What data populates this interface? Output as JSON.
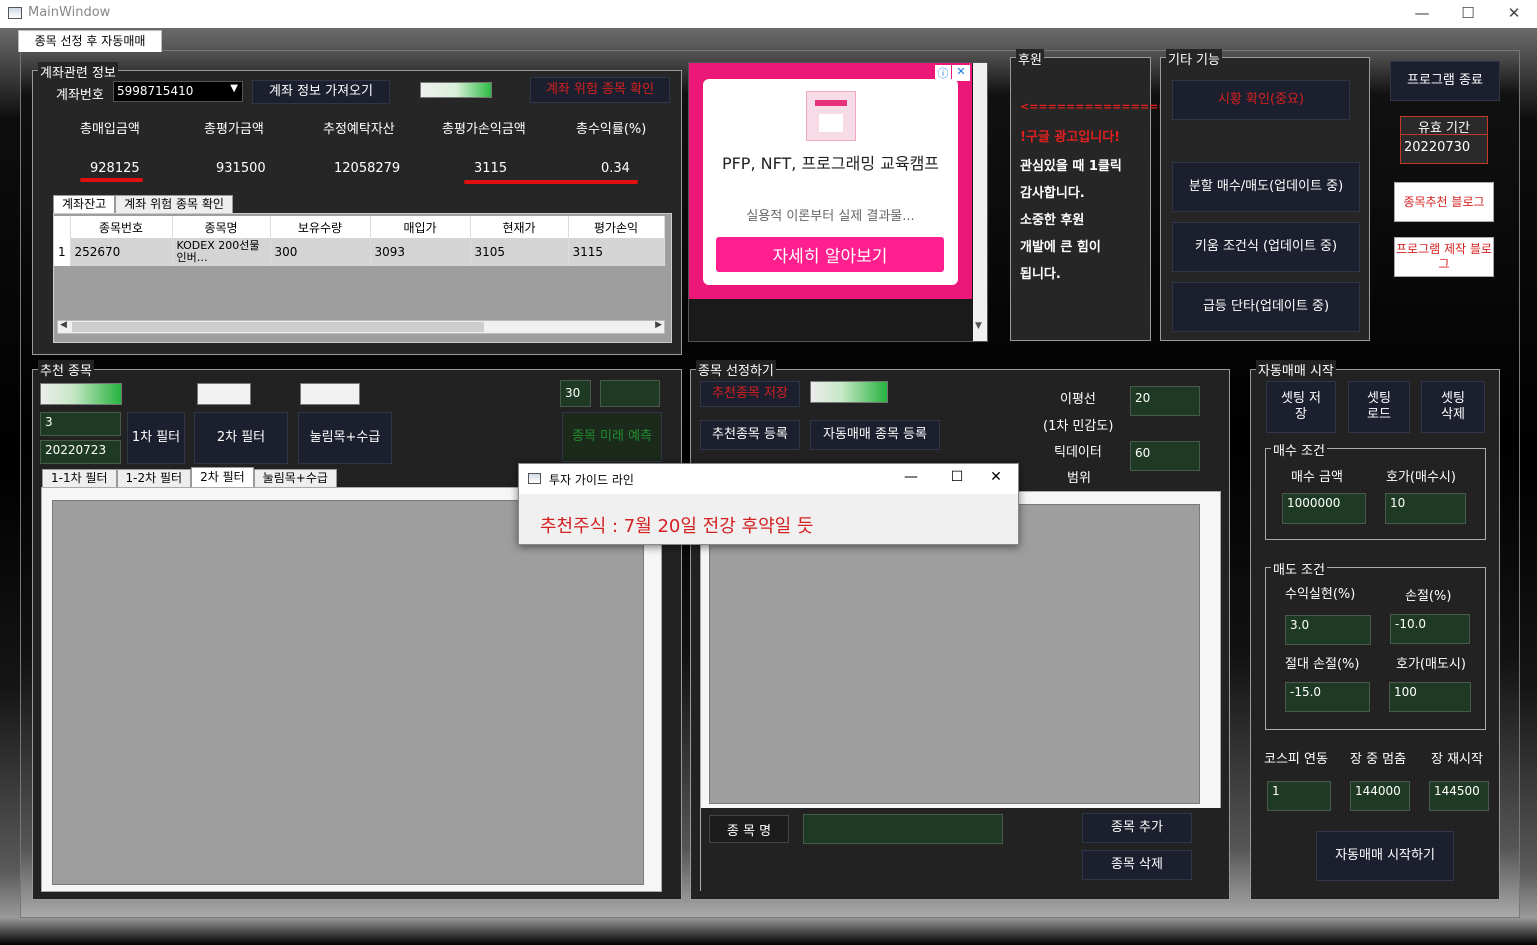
{
  "window": {
    "title": "MainWindow",
    "minimize": "—",
    "maximize": "☐",
    "close": "✕"
  },
  "page_tab": "종목 선정 후 자동매매",
  "account": {
    "legend": "계좌관련 정보",
    "account_label": "계좌번호",
    "account_number": "5998715410",
    "fetch_button": "계좌 정보 가져오기",
    "risk_button": "계좌 위험 종목 확인",
    "headers": [
      "총매입금액",
      "총평가금액",
      "추정예탁자산",
      "총평가손익금액",
      "총수익률(%)"
    ],
    "values": [
      "928125",
      "931500",
      "12058279",
      "3115",
      "0.34"
    ],
    "tabs": [
      "계좌잔고",
      "계좌 위험 종목 확인"
    ],
    "columns": [
      "종목번호",
      "종목명",
      "보유수량",
      "매입가",
      "현재가",
      "평가손익"
    ],
    "rows": [
      {
        "idx": "1",
        "code": "252670",
        "name": "KODEX 200선물인버…",
        "qty": "300",
        "buy": "3093",
        "cur": "3105",
        "pl": "3115"
      }
    ]
  },
  "ad": {
    "headline": "PFP, NFT, 프로그래밍 교육캠프",
    "sub": "실용적 이론부터 실제 결과물...",
    "cta": "자세히 알아보기",
    "info": "ⓘ",
    "close": "✕",
    "scroll_arrow": "▼"
  },
  "sponsor": {
    "legend": "후원",
    "arrow": "<===============",
    "ad_text": "!구글 광고입니다!",
    "lines": [
      "관심있을 때 1클릭",
      "감사합니다.",
      "소중한 후원",
      "개발에 큰 힘이",
      "됩니다."
    ]
  },
  "etc": {
    "legend": "기타 기능",
    "market": "시황 확인(중요)",
    "split": "분할 매수/매도(업데이트 중)",
    "kiwoom": "키움 조건식 (업데이트 중)",
    "surge": "급등 단타(업데이트 중)"
  },
  "right_top": {
    "exit": "프로그램 종료",
    "validity_label": "유효 기간",
    "validity_value": "20220730",
    "blog_recommend": "종목추천 블로그",
    "blog_dev": "프로그램 제작 블로그"
  },
  "recommend": {
    "legend": "추천 종목",
    "input1": "3",
    "input2": "20220723",
    "filter1": "1차 필터",
    "filter2": "2차 필터",
    "pullback": "눌림목+수급",
    "num": "30",
    "predict": "종목 미래 예측",
    "tabs": [
      "1-1차 필터",
      "1-2차 필터",
      "2차 필터",
      "눌림목+수급"
    ]
  },
  "select": {
    "legend": "종목 선정하기",
    "save": "추천종목 저장",
    "register": "추천종목 등록",
    "auto_register": "자동매매 종목 등록",
    "ma_label": "이평선",
    "sens_label": "(1차 민감도)",
    "tick_label": "틱데이터",
    "range_label": "범위",
    "ma_value": "20",
    "tick_value": "60",
    "name_label": "종 목 명",
    "add": "종목 추가",
    "delete": "종목 삭제"
  },
  "auto": {
    "legend": "자동매매 시작",
    "save": "셋팅 저장",
    "load": "셋팅 로드",
    "del": "셋팅 삭제",
    "buy_legend": "매수 조건",
    "buy_amount_label": "매수 금액",
    "buy_hoga_label": "호가(매수시)",
    "buy_amount": "1000000",
    "buy_hoga": "10",
    "sell_legend": "매도 조건",
    "profit_label": "수익실현(%)",
    "loss_label": "손절(%)",
    "abs_loss_label": "절대 손절(%)",
    "sell_hoga_label": "호가(매도시)",
    "profit": "3.0",
    "loss": "-10.0",
    "abs_loss": "-15.0",
    "sell_hoga": "100",
    "kospi_label": "코스피 연동",
    "halt_label": "장 중 멈춤",
    "resume_label": "장 재시작",
    "kospi": "1",
    "halt": "144000",
    "resume": "144500",
    "start": "자동매매 시작하기"
  },
  "dialog": {
    "title": "투자 가이드 라인",
    "message": "추천주식 : 7월 20일 전강 후약일 듯",
    "min": "—",
    "max": "☐",
    "close": "✕"
  },
  "colors": {
    "accent_red": "#d42020",
    "ad_pink": "#ff1f8e",
    "btn_bg": "#1c1f2e",
    "input_bg": "#1f3a24"
  }
}
